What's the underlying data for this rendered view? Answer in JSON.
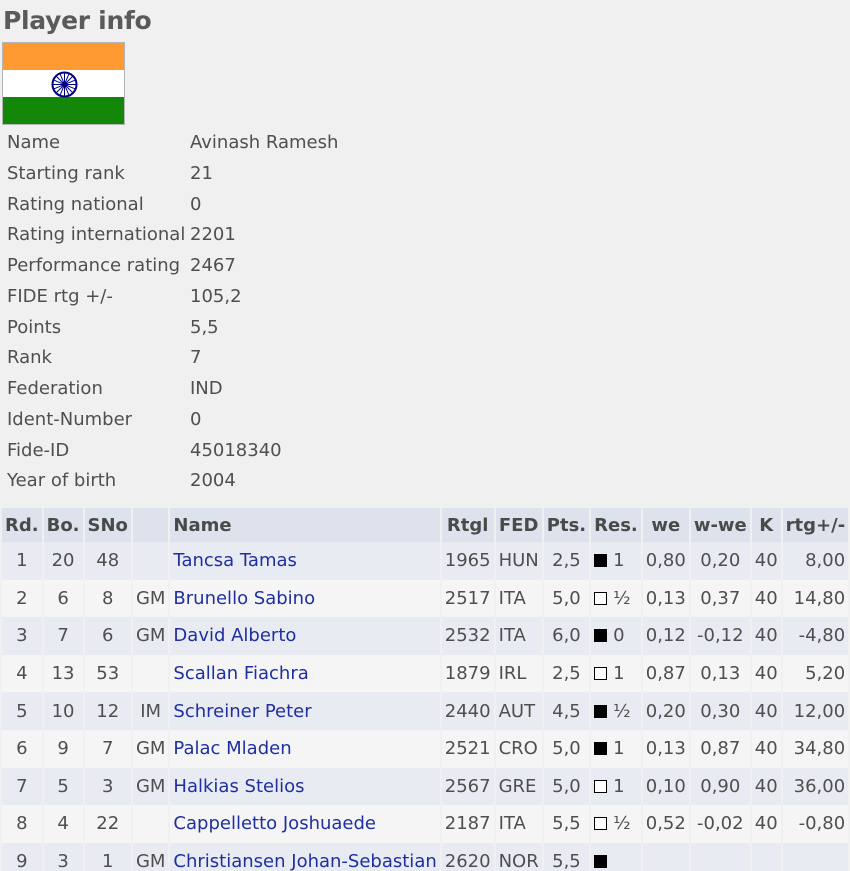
{
  "page": {
    "title": "Player info",
    "flag_colors": {
      "top": "#ff9932",
      "middle": "#ffffff",
      "bottom": "#138808",
      "wheel": "#000080"
    }
  },
  "player_info": [
    {
      "label": "Name",
      "value": "Avinash Ramesh"
    },
    {
      "label": "Starting rank",
      "value": "21"
    },
    {
      "label": "Rating national",
      "value": "0"
    },
    {
      "label": "Rating international",
      "value": "2201"
    },
    {
      "label": "Performance rating",
      "value": "2467"
    },
    {
      "label": "FIDE rtg +/-",
      "value": "105,2"
    },
    {
      "label": "Points",
      "value": "5,5"
    },
    {
      "label": "Rank",
      "value": "7"
    },
    {
      "label": "Federation",
      "value": "IND"
    },
    {
      "label": "Ident-Number",
      "value": "0"
    },
    {
      "label": "Fide-ID",
      "value": "45018340"
    },
    {
      "label": "Year of birth",
      "value": "2004"
    }
  ],
  "results_table": {
    "headers": [
      "Rd.",
      "Bo.",
      "SNo",
      "",
      "Name",
      "Rtgl",
      "FED",
      "Pts.",
      "Res.",
      "we",
      "w-we",
      "K",
      "rtg+/-"
    ],
    "rows": [
      {
        "rd": "1",
        "bo": "20",
        "sno": "48",
        "title": "",
        "name": "Tancsa Tamas",
        "rtg": "1965",
        "fed": "HUN",
        "pts": "2,5",
        "color": "black",
        "res": "1",
        "we": "0,80",
        "wwe": "0,20",
        "k": "40",
        "rtgdiff": "8,00"
      },
      {
        "rd": "2",
        "bo": "6",
        "sno": "8",
        "title": "GM",
        "name": "Brunello Sabino",
        "rtg": "2517",
        "fed": "ITA",
        "pts": "5,0",
        "color": "white",
        "res": "½",
        "we": "0,13",
        "wwe": "0,37",
        "k": "40",
        "rtgdiff": "14,80"
      },
      {
        "rd": "3",
        "bo": "7",
        "sno": "6",
        "title": "GM",
        "name": "David Alberto",
        "rtg": "2532",
        "fed": "ITA",
        "pts": "6,0",
        "color": "black",
        "res": "0",
        "we": "0,12",
        "wwe": "-0,12",
        "k": "40",
        "rtgdiff": "-4,80"
      },
      {
        "rd": "4",
        "bo": "13",
        "sno": "53",
        "title": "",
        "name": "Scallan Fiachra",
        "rtg": "1879",
        "fed": "IRL",
        "pts": "2,5",
        "color": "white",
        "res": "1",
        "we": "0,87",
        "wwe": "0,13",
        "k": "40",
        "rtgdiff": "5,20"
      },
      {
        "rd": "5",
        "bo": "10",
        "sno": "12",
        "title": "IM",
        "name": "Schreiner Peter",
        "rtg": "2440",
        "fed": "AUT",
        "pts": "4,5",
        "color": "black",
        "res": "½",
        "we": "0,20",
        "wwe": "0,30",
        "k": "40",
        "rtgdiff": "12,00"
      },
      {
        "rd": "6",
        "bo": "9",
        "sno": "7",
        "title": "GM",
        "name": "Palac Mladen",
        "rtg": "2521",
        "fed": "CRO",
        "pts": "5,0",
        "color": "black",
        "res": "1",
        "we": "0,13",
        "wwe": "0,87",
        "k": "40",
        "rtgdiff": "34,80"
      },
      {
        "rd": "7",
        "bo": "5",
        "sno": "3",
        "title": "GM",
        "name": "Halkias Stelios",
        "rtg": "2567",
        "fed": "GRE",
        "pts": "5,0",
        "color": "white",
        "res": "1",
        "we": "0,10",
        "wwe": "0,90",
        "k": "40",
        "rtgdiff": "36,00"
      },
      {
        "rd": "8",
        "bo": "4",
        "sno": "22",
        "title": "",
        "name": "Cappelletto Joshuaede",
        "rtg": "2187",
        "fed": "ITA",
        "pts": "5,5",
        "color": "white",
        "res": "½",
        "we": "0,52",
        "wwe": "-0,02",
        "k": "40",
        "rtgdiff": "-0,80"
      },
      {
        "rd": "9",
        "bo": "3",
        "sno": "1",
        "title": "GM",
        "name": "Christiansen Johan-Sebastian",
        "rtg": "2620",
        "fed": "NOR",
        "pts": "5,5",
        "color": "black",
        "res": "",
        "we": "",
        "wwe": "",
        "k": "",
        "rtgdiff": ""
      }
    ]
  }
}
